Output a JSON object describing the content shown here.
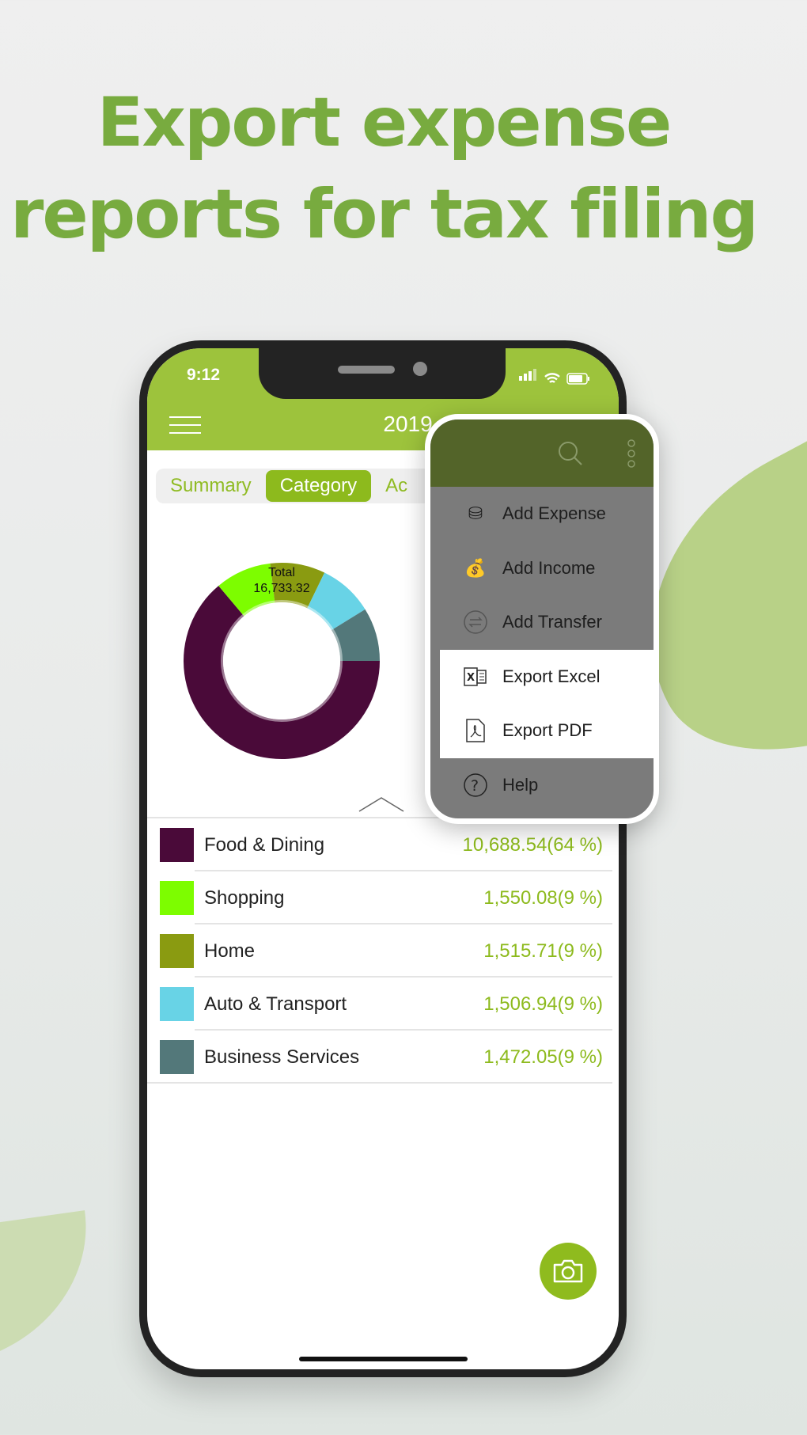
{
  "headline": {
    "line1": "Export expense",
    "line2": "reports for tax filing"
  },
  "status_bar": {
    "time": "9:12"
  },
  "header": {
    "year": "2019",
    "year_dropdown_icon": "triangle-down-icon",
    "menu_icon": "hamburger-icon"
  },
  "tabs": [
    {
      "label": "Summary"
    },
    {
      "label": "Category",
      "active": true
    },
    {
      "label": "Ac"
    }
  ],
  "donut": {
    "center_label": "Total",
    "center_value": "16,733.32"
  },
  "categories": [
    {
      "name": "Food & Dining",
      "amount": "10,688.54(64 %)",
      "value": 10688.54,
      "color": "#4a0a39"
    },
    {
      "name": "Shopping",
      "amount": "1,550.08(9 %)",
      "value": 1550.08,
      "color": "#7dfd00"
    },
    {
      "name": "Home",
      "amount": "1,515.71(9 %)",
      "value": 1515.71,
      "color": "#8a9b11"
    },
    {
      "name": "Auto & Transport",
      "amount": "1,506.94(9 %)",
      "value": 1506.94,
      "color": "#68d3e6"
    },
    {
      "name": "Business Services",
      "amount": "1,472.05(9 %)",
      "value": 1472.05,
      "color": "#53787a"
    }
  ],
  "menu": {
    "header_icons": [
      "search-icon",
      "more-vertical-icon"
    ],
    "items": [
      {
        "label": "Add Expense",
        "icon": "coins-icon"
      },
      {
        "label": "Add Income",
        "icon": "money-bag-icon"
      },
      {
        "label": "Add Transfer",
        "icon": "transfer-icon"
      },
      {
        "label": "Export Excel",
        "icon": "excel-icon"
      },
      {
        "label": "Export PDF",
        "icon": "pdf-icon"
      },
      {
        "label": "Help",
        "icon": "help-icon"
      }
    ]
  },
  "fab": {
    "icon": "camera-icon"
  },
  "colors": {
    "brand": "#9dc33c",
    "headline": "#78ab3f",
    "menu_header": "#536429"
  }
}
